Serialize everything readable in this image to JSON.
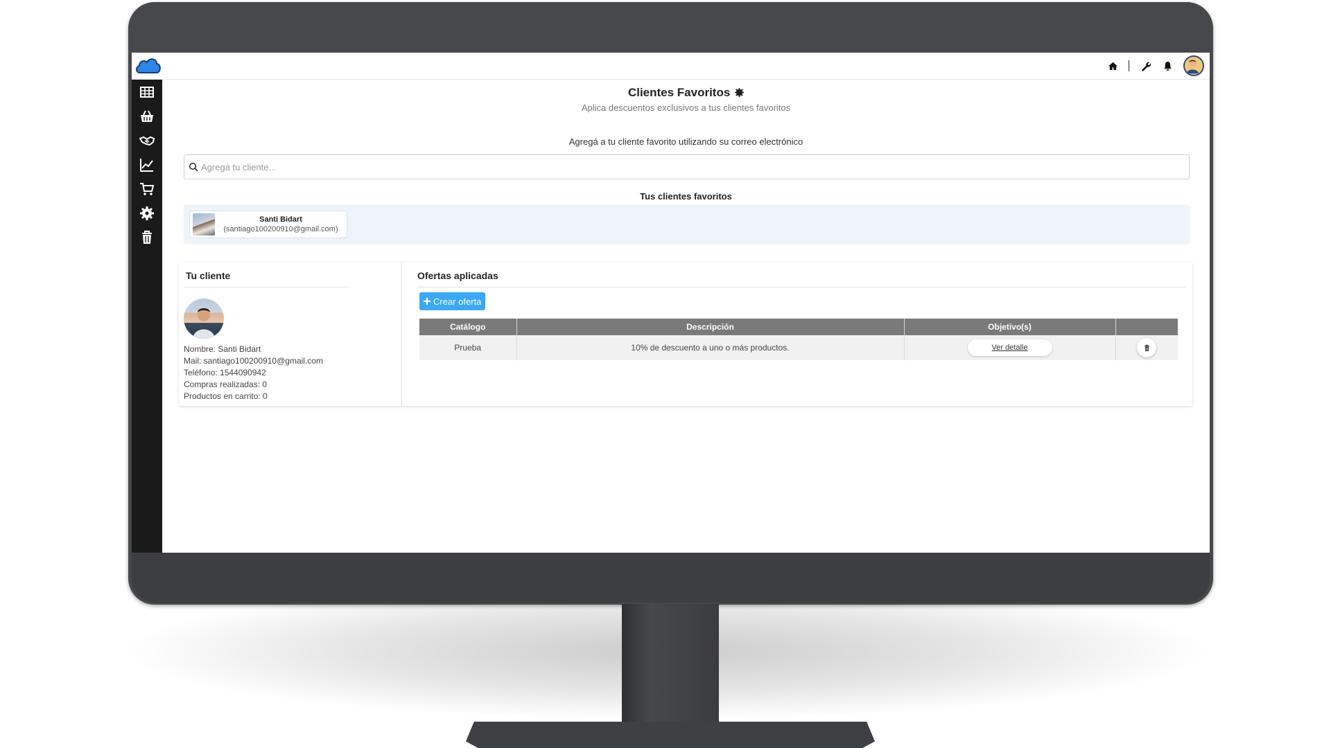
{
  "header": {
    "icons": [
      "home-icon",
      "wrench-icon",
      "bell-icon",
      "user-avatar"
    ]
  },
  "sidebar": {
    "items": [
      "grid-icon",
      "basket-icon",
      "handshake-icon",
      "chart-icon",
      "cart-icon",
      "gear-icon",
      "trash-icon"
    ]
  },
  "page": {
    "title": "Clientes Favoritos",
    "subtitle": "Aplica descuentos exclusivos a tus clientes favoritos",
    "add_label": "Agregá a tu cliente favorito utilizando su correo electrónico",
    "search_placeholder": "Agregá tu cliente...",
    "favorites_title": "Tus clientes favoritos"
  },
  "favorites": [
    {
      "name": "Santi Bidart",
      "email": "(santiago100200910@gmail.com)"
    }
  ],
  "client": {
    "section_title": "Tu cliente",
    "name_line": "Nombre: Santi Bidart",
    "mail_line": "Mail: santiago100200910@gmail.com",
    "phone_line": "Teléfono: 1544090942",
    "purchases_line": "Compras realizadas: 0",
    "cart_line": "Productos en carrito: 0"
  },
  "offers": {
    "section_title": "Ofertas aplicadas",
    "create_label": "Crear oferta",
    "columns": [
      "Catálogo",
      "Descripción",
      "Objetivo(s)",
      ""
    ],
    "rows": [
      {
        "catalog": "Prueba",
        "description": "10% de descuento a uno o más productos.",
        "objective_label": "Ver detalle"
      }
    ]
  },
  "colors": {
    "accent": "#3aa8f5",
    "sidebar": "#1a1a1a",
    "table_header": "#7a7a7a",
    "favorites_panel": "#eef4fb",
    "cloud_logo": "#2f86e6"
  }
}
